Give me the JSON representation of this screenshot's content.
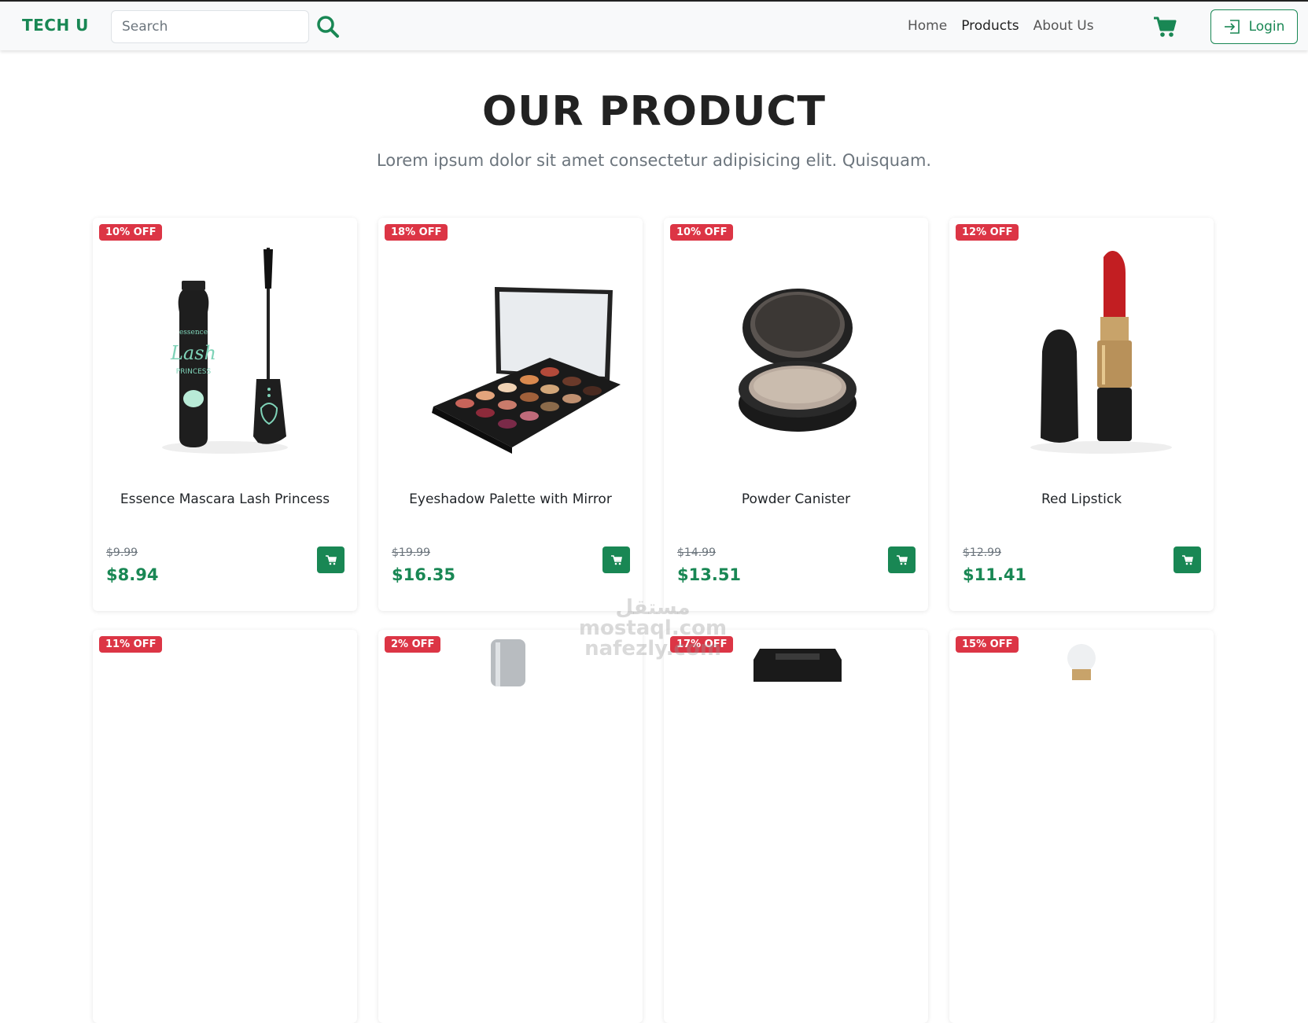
{
  "navbar": {
    "brand": "TECH U",
    "search_placeholder": "Search",
    "links": [
      "Home",
      "Products",
      "About Us"
    ],
    "login_label": "Login",
    "accent_color": "#198754"
  },
  "hero": {
    "title": "OUR PRODUCT",
    "subtitle": "Lorem ipsum dolor sit amet consectetur adipisicing elit. Quisquam."
  },
  "products": [
    {
      "badge": "10% OFF",
      "title": "Essence Mascara Lash Princess",
      "old_price": "$9.99",
      "price": "$8.94",
      "image": "mascara"
    },
    {
      "badge": "18% OFF",
      "title": "Eyeshadow Palette with Mirror",
      "old_price": "$19.99",
      "price": "$16.35",
      "image": "eyeshadow-palette"
    },
    {
      "badge": "10% OFF",
      "title": "Powder Canister",
      "old_price": "$14.99",
      "price": "$13.51",
      "image": "powder-compact"
    },
    {
      "badge": "12% OFF",
      "title": "Red Lipstick",
      "old_price": "$12.99",
      "price": "$11.41",
      "image": "lipstick"
    },
    {
      "badge": "11% OFF",
      "image": "blank"
    },
    {
      "badge": "2% OFF",
      "image": "bottle"
    },
    {
      "badge": "17% OFF",
      "image": "perfume"
    },
    {
      "badge": "15% OFF",
      "image": "bulb"
    }
  ],
  "watermark": "مستقل mostaql.com nafezly.com",
  "colors": {
    "badge": "#dc3545",
    "price": "#198754"
  }
}
